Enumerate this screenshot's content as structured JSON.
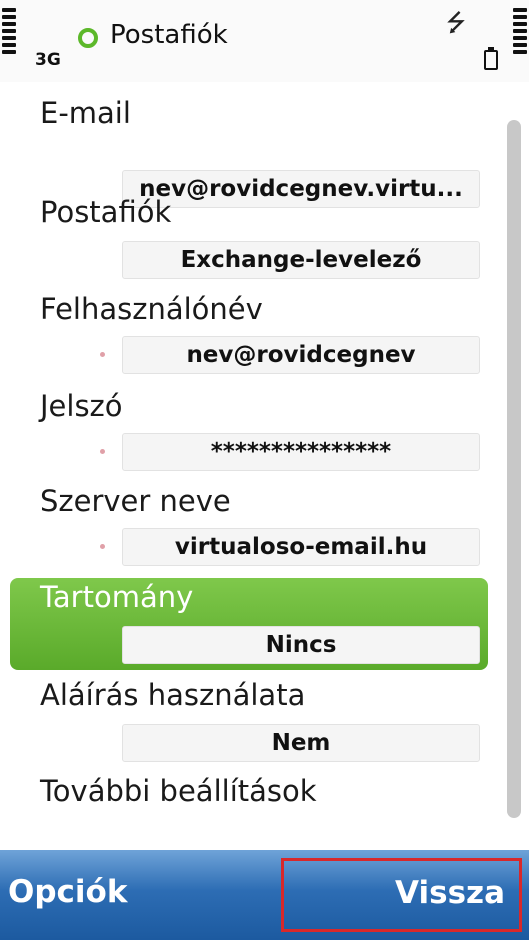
{
  "status": {
    "network": "3G",
    "app_title": "Postafiók",
    "usb_symbol": "⭍"
  },
  "settings": [
    {
      "label": "E-mail",
      "value": "nev@rovidcegnev.virtu...",
      "required": false
    },
    {
      "label": "Postafiók",
      "value": "Exchange-levelező",
      "required": false
    },
    {
      "label": "Felhasználónév",
      "value": "nev@rovidcegnev",
      "required": true
    },
    {
      "label": "Jelszó",
      "value": "***************",
      "required": true
    },
    {
      "label": "Szerver neve",
      "value": "virtualoso-email.hu",
      "required": true
    },
    {
      "label": "Tartomány",
      "value": "Nincs",
      "required": false,
      "selected": true
    },
    {
      "label": "Aláírás használata",
      "value": "Nem",
      "required": false
    },
    {
      "label": "További beállítások"
    }
  ],
  "softkeys": {
    "left": "Opciók",
    "right": "Vissza"
  },
  "colors": {
    "selection": "#66b533",
    "softkey_bar": "#2d6db4",
    "highlight_border": "#d8282a"
  }
}
